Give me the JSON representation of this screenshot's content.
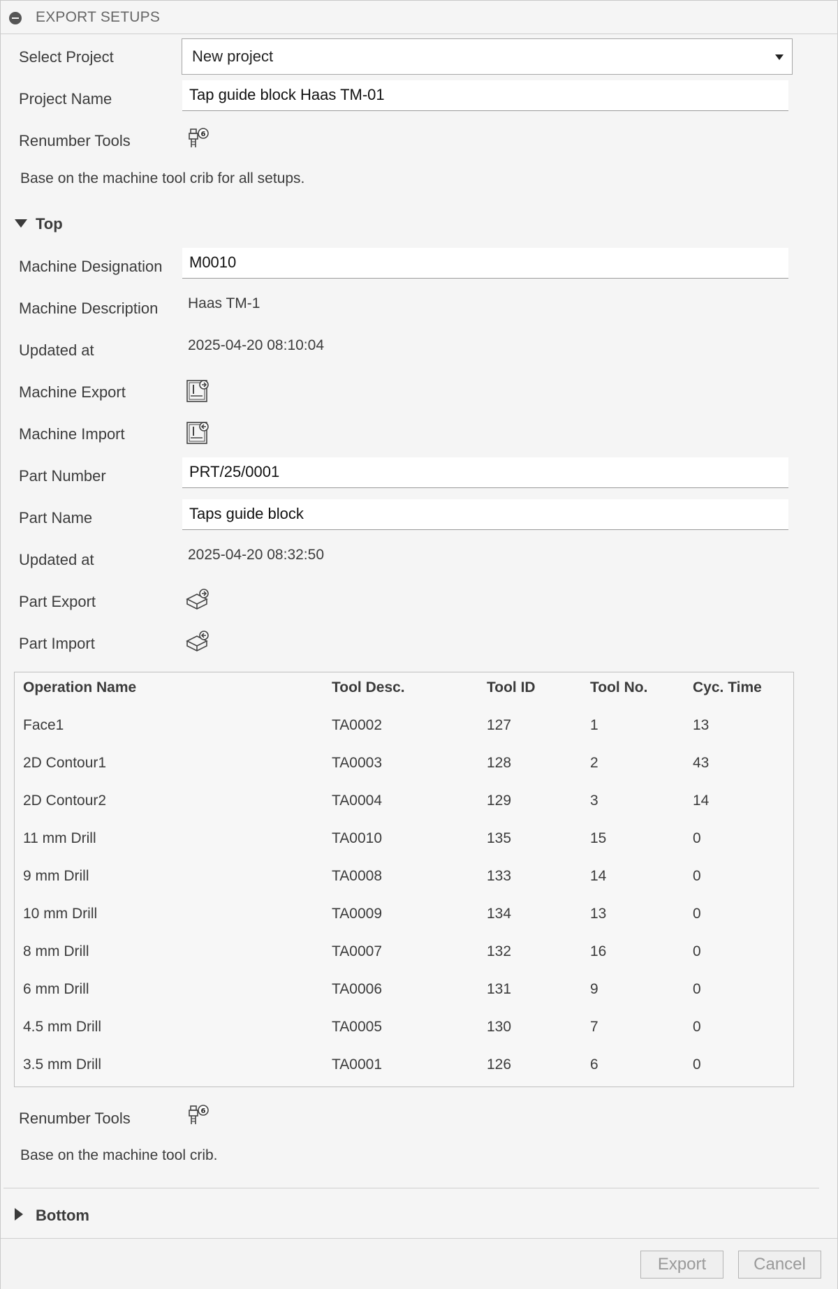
{
  "dialog": {
    "title": "EXPORT SETUPS"
  },
  "project": {
    "select_label": "Select Project",
    "select_value": "New project",
    "name_label": "Project Name",
    "name_value": "Tap guide block Haas TM-01",
    "renumber_label": "Renumber Tools",
    "renumber_note": "Base on the machine tool crib for all setups."
  },
  "top": {
    "heading": "Top",
    "machine_designation_label": "Machine Designation",
    "machine_designation_value": "M0010",
    "machine_description_label": "Machine Description",
    "machine_description_value": "Haas TM-1",
    "machine_updated_label": "Updated at",
    "machine_updated_value": "2025-04-20 08:10:04",
    "machine_export_label": "Machine Export",
    "machine_import_label": "Machine Import",
    "part_number_label": "Part Number",
    "part_number_value": "PRT/25/0001",
    "part_name_label": "Part Name",
    "part_name_value": "Taps guide block",
    "part_updated_label": "Updated at",
    "part_updated_value": "2025-04-20 08:32:50",
    "part_export_label": "Part Export",
    "part_import_label": "Part Import",
    "table": {
      "headers": [
        "Operation Name",
        "Tool Desc.",
        "Tool ID",
        "Tool No.",
        "Cyc. Time"
      ],
      "rows": [
        [
          "Face1",
          "TA0002",
          "127",
          "1",
          "13"
        ],
        [
          "2D Contour1",
          "TA0003",
          "128",
          "2",
          "43"
        ],
        [
          "2D Contour2",
          "TA0004",
          "129",
          "3",
          "14"
        ],
        [
          "11 mm Drill",
          "TA0010",
          "135",
          "15",
          "0"
        ],
        [
          "9 mm Drill",
          "TA0008",
          "133",
          "14",
          "0"
        ],
        [
          "10 mm Drill",
          "TA0009",
          "134",
          "13",
          "0"
        ],
        [
          "8 mm Drill",
          "TA0007",
          "132",
          "16",
          "0"
        ],
        [
          "6 mm Drill",
          "TA0006",
          "131",
          "9",
          "0"
        ],
        [
          "4.5 mm Drill",
          "TA0005",
          "130",
          "7",
          "0"
        ],
        [
          "3.5 mm Drill",
          "TA0001",
          "126",
          "6",
          "0"
        ]
      ]
    },
    "renumber_label": "Renumber Tools",
    "renumber_note": "Base on the machine tool crib."
  },
  "bottom": {
    "heading": "Bottom"
  },
  "footer": {
    "export_label": "Export",
    "cancel_label": "Cancel"
  },
  "icons": {
    "title": "collapse-icon",
    "renumber": "tool-renumber-icon",
    "machine_export": "machine-export-icon",
    "machine_import": "machine-import-icon",
    "part_export": "part-export-icon",
    "part_import": "part-import-icon"
  }
}
